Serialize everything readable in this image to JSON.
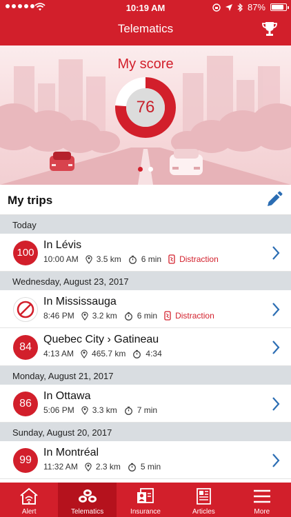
{
  "status": {
    "time": "10:19 AM",
    "battery": "87%",
    "battery_level": 0.87
  },
  "header": {
    "title": "Telematics",
    "trophy_icon": "trophy-icon"
  },
  "score": {
    "title": "My score",
    "value": "76",
    "fraction": 0.76,
    "page_index": 0,
    "page_count": 2
  },
  "trips": {
    "title": "My trips",
    "edit_icon": "pencil-icon",
    "days": [
      {
        "label": "Today",
        "items": [
          {
            "badge": "100",
            "badge_kind": "score",
            "title": "In Lévis",
            "time": "10:00 AM",
            "distance": "3.5 km",
            "duration": "6 min",
            "flag": "Distraction"
          }
        ]
      },
      {
        "label": "Wednesday, August 23, 2017",
        "items": [
          {
            "badge": "",
            "badge_kind": "none",
            "title": "In Mississauga",
            "time": "8:46 PM",
            "distance": "3.2 km",
            "duration": "6 min",
            "flag": "Distraction"
          },
          {
            "badge": "84",
            "badge_kind": "score",
            "title": "Quebec City › Gatineau",
            "time": "4:13 AM",
            "distance": "465.7 km",
            "duration": "4:34",
            "flag": ""
          }
        ]
      },
      {
        "label": "Monday, August 21, 2017",
        "items": [
          {
            "badge": "86",
            "badge_kind": "score",
            "title": "In Ottawa",
            "time": "5:06 PM",
            "distance": "3.3 km",
            "duration": "7 min",
            "flag": ""
          }
        ]
      },
      {
        "label": "Sunday, August 20, 2017",
        "items": [
          {
            "badge": "99",
            "badge_kind": "score",
            "title": "In Montréal",
            "time": "11:32 AM",
            "distance": "2.3 km",
            "duration": "5 min",
            "flag": ""
          }
        ]
      }
    ]
  },
  "tabs": [
    {
      "label": "Alert",
      "icon": "house-alert-icon",
      "active": false
    },
    {
      "label": "Telematics",
      "icon": "telematics-icon",
      "active": true
    },
    {
      "label": "Insurance",
      "icon": "insurance-card-icon",
      "active": false
    },
    {
      "label": "Articles",
      "icon": "newspaper-icon",
      "active": false
    },
    {
      "label": "More",
      "icon": "menu-icon",
      "active": false
    }
  ],
  "colors": {
    "brand_red": "#d21f2b",
    "day_header_bg": "#d9dde1"
  }
}
